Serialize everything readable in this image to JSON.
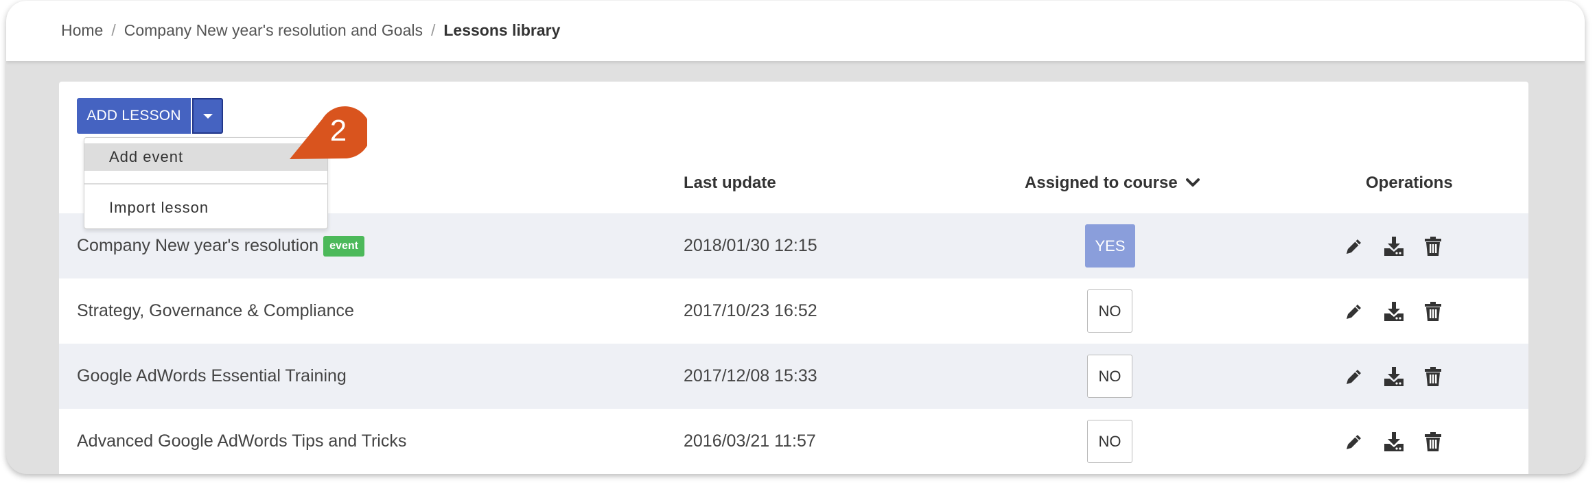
{
  "breadcrumb": {
    "home": "Home",
    "course": "Company New year's resolution and Goals",
    "current": "Lessons library",
    "separator": "/"
  },
  "toolbar": {
    "add_lesson_label": "ADD LESSON",
    "dropdown_toggle_icon": "caret-down-icon"
  },
  "dropdown_menu": {
    "items": [
      {
        "label": "Add event",
        "active": true
      },
      {
        "label": "Import lesson",
        "active": false
      }
    ]
  },
  "step_badge": {
    "number": "2",
    "color": "#d9541e"
  },
  "table": {
    "columns": {
      "last_update": "Last update",
      "assigned": "Assigned to course",
      "assigned_sort_icon": "chevron-down-icon",
      "operations": "Operations"
    },
    "rows": [
      {
        "title": "Company New year's resolution",
        "badge": "event",
        "last_update": "2018/01/30 12:15",
        "assigned": "YES"
      },
      {
        "title": "Strategy, Governance & Compliance",
        "badge": "",
        "last_update": "2017/10/23 16:52",
        "assigned": "NO"
      },
      {
        "title": "Google AdWords Essential Training",
        "badge": "",
        "last_update": "2017/12/08 15:33",
        "assigned": "NO"
      },
      {
        "title": "Advanced Google AdWords Tips and Tricks",
        "badge": "",
        "last_update": "2016/03/21 11:57",
        "assigned": "NO"
      }
    ],
    "operation_icons": [
      "pencil-icon",
      "download-icon",
      "trash-icon"
    ]
  },
  "colors": {
    "primary": "#4563c1",
    "assigned_yes": "#8a9edb",
    "event_badge": "#4cb95a",
    "row_alt": "#eef0f5",
    "page_bg": "#e0e0e0"
  }
}
